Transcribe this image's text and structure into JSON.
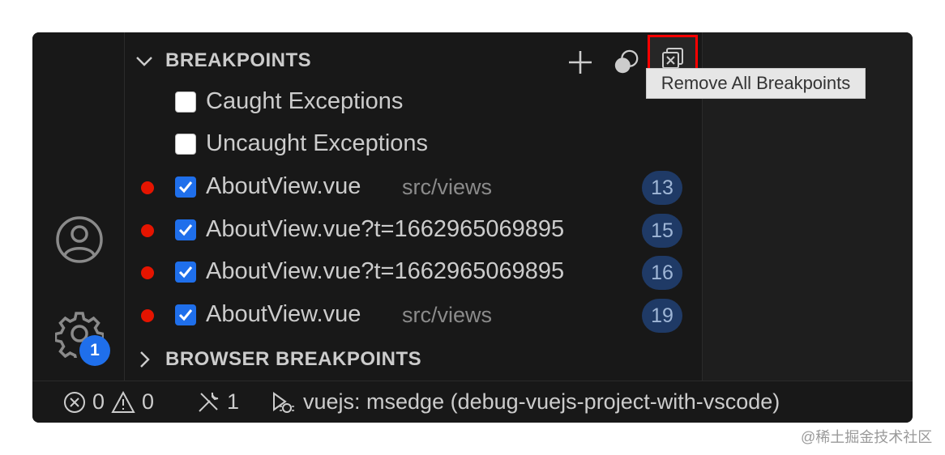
{
  "breakpoints_section": {
    "title": "BREAKPOINTS",
    "actions": {
      "add": "add-icon",
      "toggle_activate": "toggle-breakpoints-icon",
      "remove_all": "remove-all-icon"
    },
    "items": [
      {
        "label": "Caught Exceptions",
        "checked": false,
        "has_dot": false
      },
      {
        "label": "Uncaught Exceptions",
        "checked": false,
        "has_dot": false
      },
      {
        "label": "AboutView.vue",
        "path": "src/views",
        "line": "13",
        "checked": true,
        "has_dot": true
      },
      {
        "label": "AboutView.vue?t=1662965069895",
        "path": "",
        "line": "15",
        "checked": true,
        "has_dot": true
      },
      {
        "label": "AboutView.vue?t=1662965069895",
        "path": "",
        "line": "16",
        "checked": true,
        "has_dot": true
      },
      {
        "label": "AboutView.vue",
        "path": "src/views",
        "line": "19",
        "checked": true,
        "has_dot": true
      }
    ]
  },
  "browser_breakpoints_section": {
    "title": "BROWSER BREAKPOINTS"
  },
  "tooltip": {
    "text": "Remove All Breakpoints"
  },
  "activity_bar": {
    "settings_badge": "1"
  },
  "status_bar": {
    "errors": "0",
    "warnings": "0",
    "ports": "1",
    "debug_session": "vuejs: msedge (debug-vuejs-project-with-vscode)"
  },
  "watermark": "@稀土掘金技术社区",
  "colors": {
    "background": "#1e1e1e",
    "breakpoint_dot": "#e51400",
    "checkbox_checked": "#1f6feb",
    "highlight_border": "#ff0000"
  }
}
